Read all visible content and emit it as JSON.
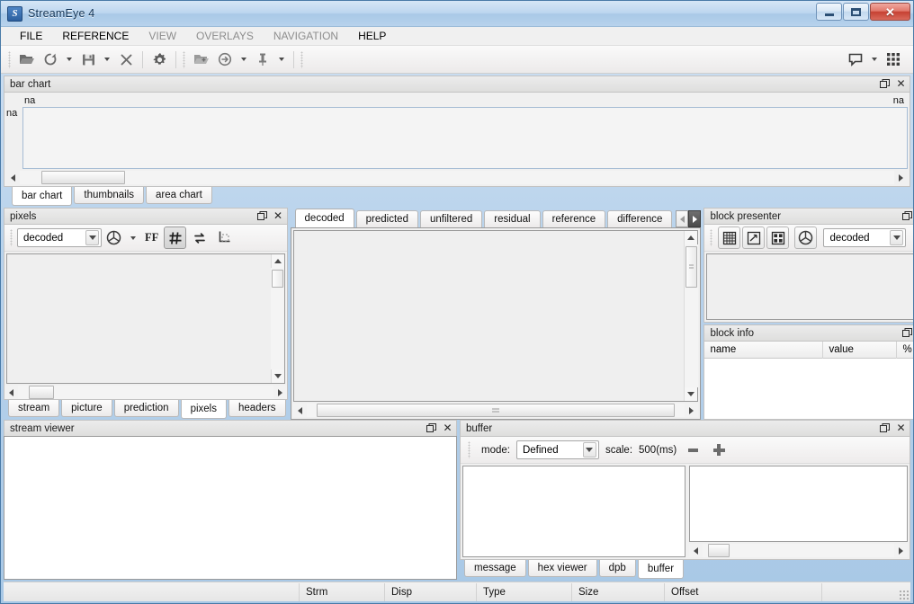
{
  "window": {
    "title": "StreamEye 4",
    "app_icon": "S",
    "controls": {
      "minimize": "minimize-icon",
      "maximize": "maximize-icon",
      "close": "close-icon"
    }
  },
  "menubar": {
    "items": [
      {
        "label": "FILE",
        "enabled": true
      },
      {
        "label": "REFERENCE",
        "enabled": true
      },
      {
        "label": "VIEW",
        "enabled": false
      },
      {
        "label": "OVERLAYS",
        "enabled": false
      },
      {
        "label": "NAVIGATION",
        "enabled": false
      },
      {
        "label": "HELP",
        "enabled": true
      }
    ]
  },
  "toolbar": {
    "left_group": [
      "open-folder-icon",
      "reload-icon",
      "save-icon",
      "close-x-icon"
    ],
    "settings": "gear-icon",
    "right_group": [
      "add-folder-icon",
      "goto-icon",
      "pin-icon"
    ],
    "far_right": [
      "comment-icon",
      "grid-apps-icon"
    ]
  },
  "bar_chart_panel": {
    "title": "bar chart",
    "label_top_left": "na",
    "label_top_right": "na",
    "label_left": "na",
    "tabs": [
      {
        "label": "bar chart",
        "active": true
      },
      {
        "label": "thumbnails",
        "active": false
      },
      {
        "label": "area chart",
        "active": false
      }
    ]
  },
  "pixels_panel": {
    "title": "pixels",
    "mode_value": "decoded",
    "ff_label": "FF",
    "icons": [
      "colorwheel-icon",
      "chevron-down-icon",
      "grid-hash-icon",
      "swap-icon",
      "crop-icon"
    ],
    "tabs": [
      {
        "label": "stream",
        "active": false
      },
      {
        "label": "picture",
        "active": false
      },
      {
        "label": "prediction",
        "active": false
      },
      {
        "label": "pixels",
        "active": true
      },
      {
        "label": "headers",
        "active": false
      }
    ]
  },
  "center_panel": {
    "tabs": [
      {
        "label": "decoded",
        "active": true
      },
      {
        "label": "predicted",
        "active": false
      },
      {
        "label": "unfiltered",
        "active": false
      },
      {
        "label": "residual",
        "active": false
      },
      {
        "label": "reference",
        "active": false
      },
      {
        "label": "difference",
        "active": false
      }
    ]
  },
  "block_presenter": {
    "title": "block presenter",
    "buttons": [
      "grid-view-icon",
      "motion-vectors-icon",
      "blocks-view-icon",
      "colorwheel-icon"
    ],
    "mode_value": "decoded"
  },
  "block_info": {
    "title": "block info",
    "columns": [
      "name",
      "value",
      "%"
    ],
    "rows": []
  },
  "stream_viewer": {
    "title": "stream viewer"
  },
  "buffer_panel": {
    "title": "buffer",
    "mode_label": "mode:",
    "mode_value": "Defined",
    "scale_label": "scale:",
    "scale_value": "500(ms)",
    "decrease": "minus-icon",
    "increase": "plus-icon",
    "tabs": [
      {
        "label": "message",
        "active": false
      },
      {
        "label": "hex viewer",
        "active": false
      },
      {
        "label": "dpb",
        "active": false
      },
      {
        "label": "buffer",
        "active": true
      }
    ]
  },
  "statusbar": {
    "cells": [
      "Strm",
      "Disp",
      "Type",
      "Size",
      "Offset"
    ]
  },
  "colors": {
    "title_blue": "#1d5a96",
    "close_red": "#c64132",
    "panel_grey": "#f0f0f0",
    "border": "#c3c3c3"
  }
}
